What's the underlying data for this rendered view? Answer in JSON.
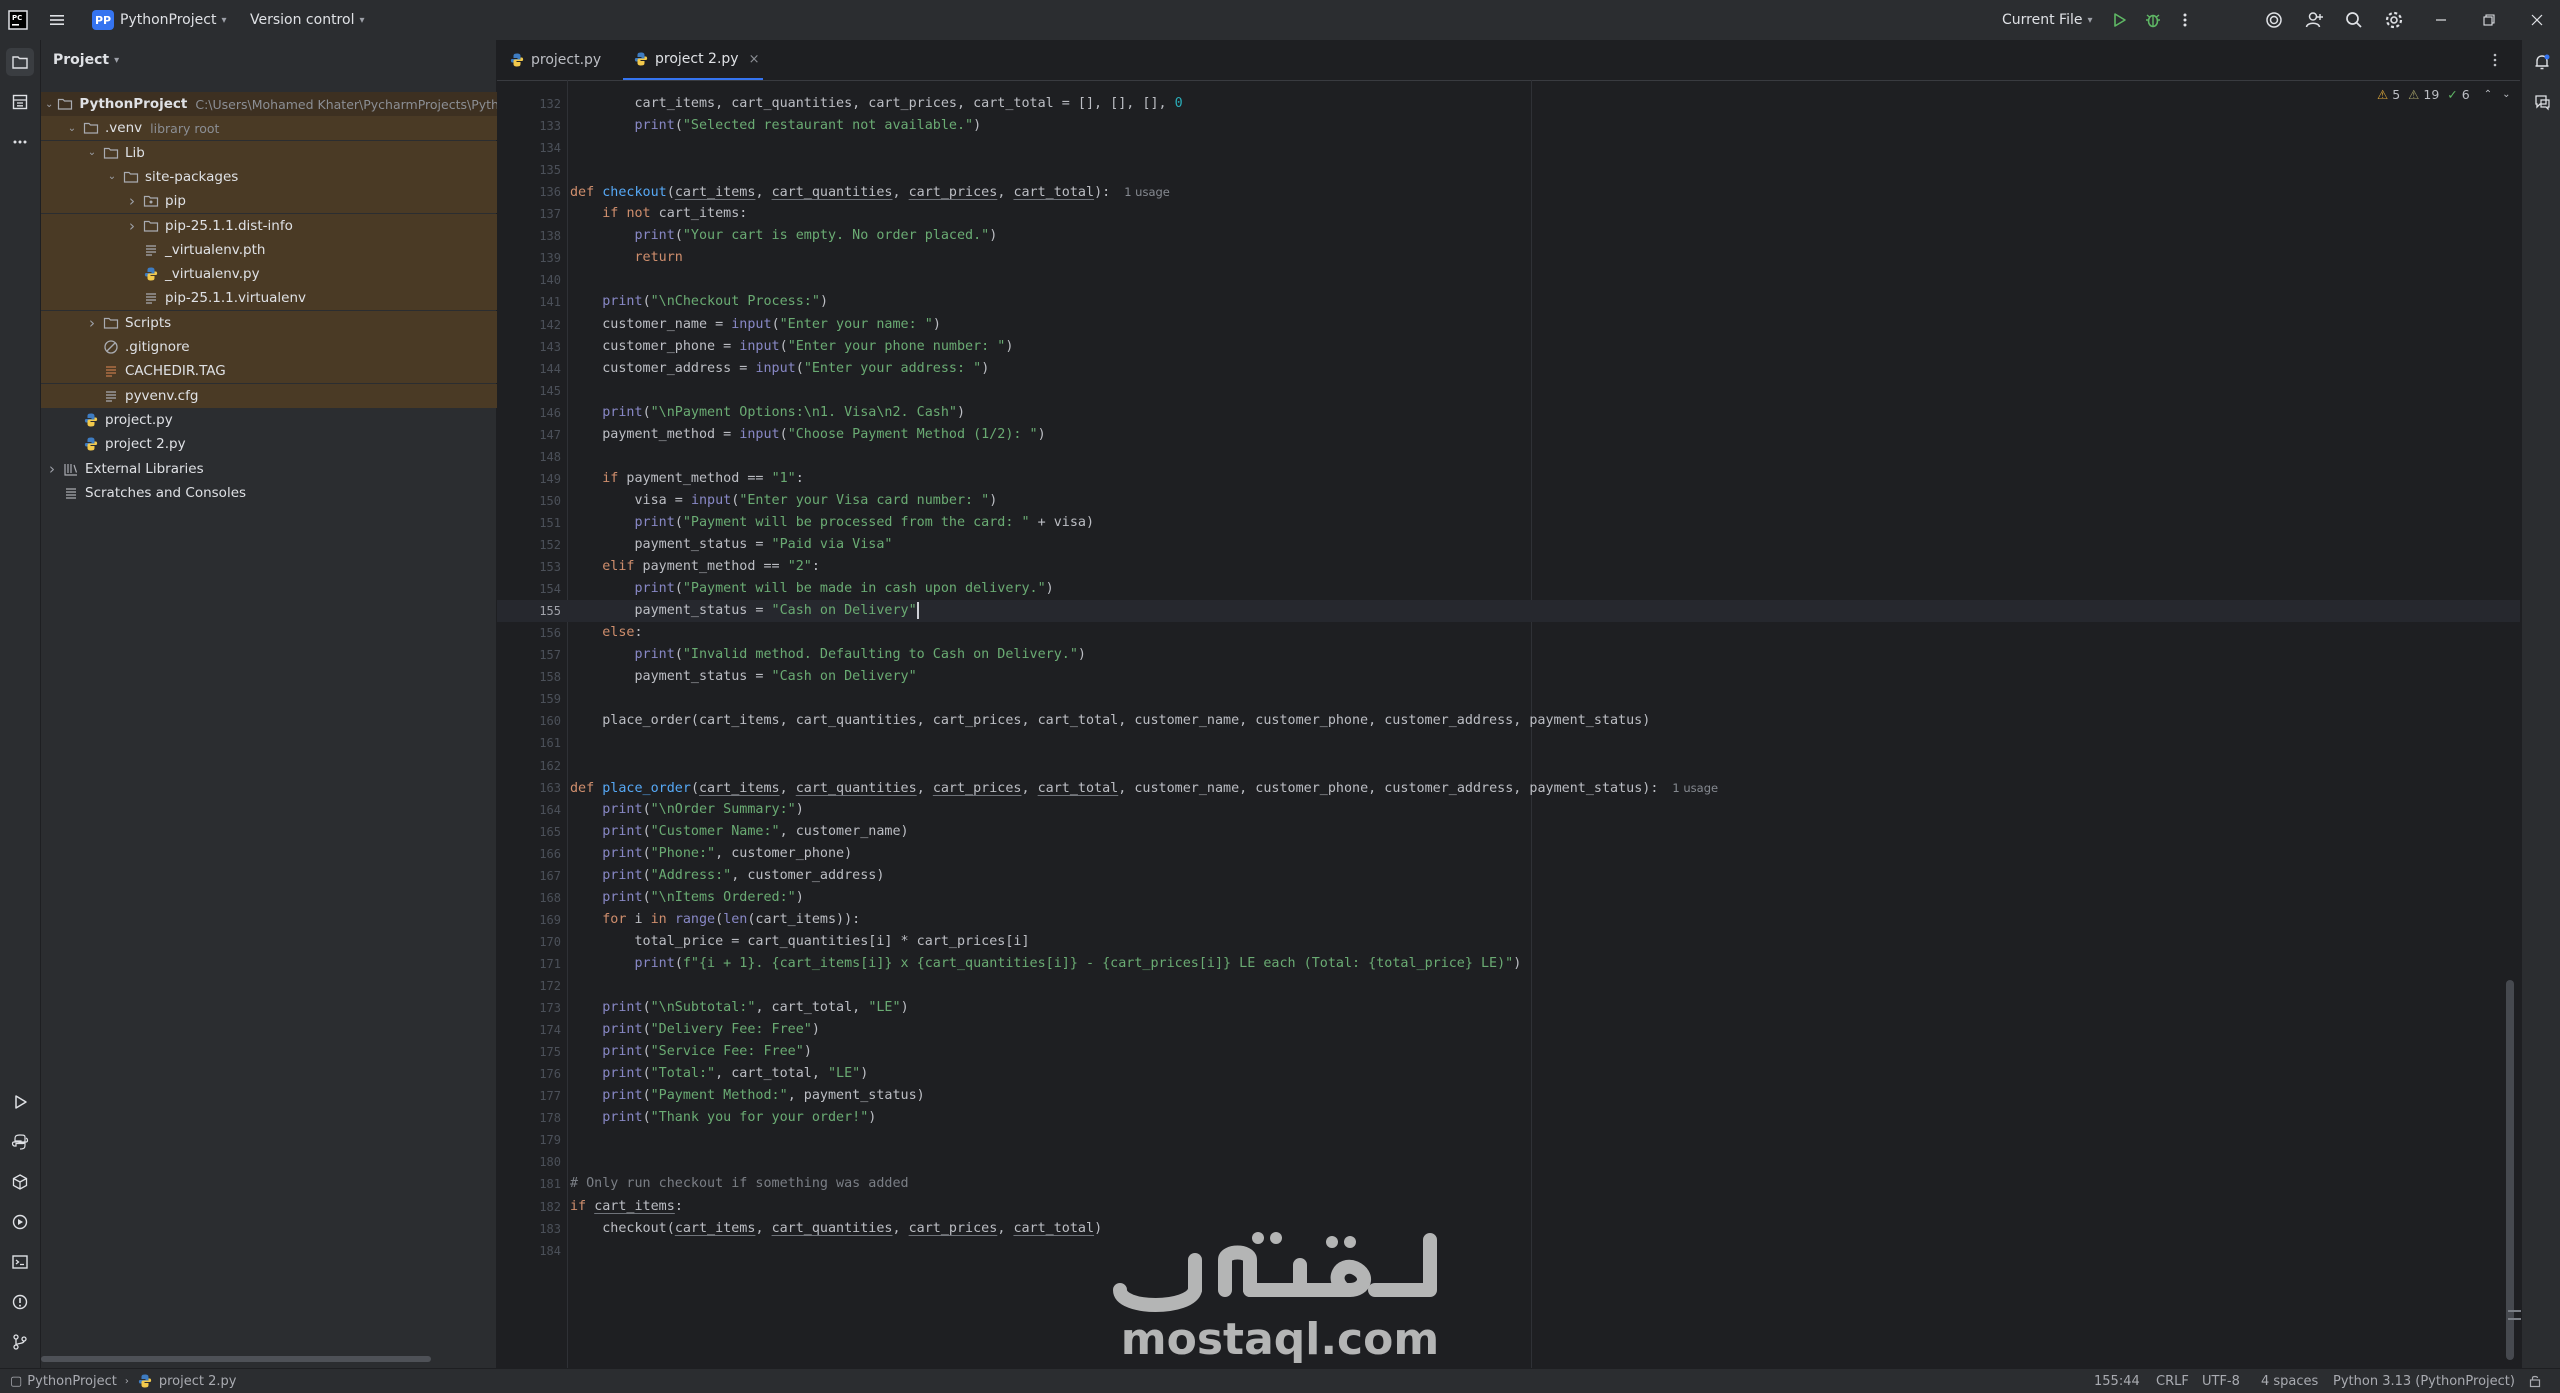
{
  "titlebar": {
    "project_badge": "PP",
    "project_name": "PythonProject",
    "vcs": "Version control",
    "run_config": "Current File"
  },
  "project_panel": {
    "title": "Project",
    "tree": [
      {
        "label": "PythonProject",
        "extra": "C:\\Users\\Mohamed Khater\\PycharmProjects\\PythonProject",
        "indent": 1,
        "twisty": "down",
        "icon": "folder-icon",
        "bold": true
      },
      {
        "label": ".venv",
        "extra": "library root",
        "indent": 2,
        "twisty": "down",
        "icon": "folder-icon"
      },
      {
        "label": "Lib",
        "extra": "",
        "indent": 3,
        "twisty": "down",
        "icon": "folder-icon"
      },
      {
        "label": "site-packages",
        "extra": "",
        "indent": 4,
        "twisty": "down",
        "icon": "folder-icon"
      },
      {
        "label": "pip",
        "extra": "",
        "indent": 5,
        "twisty": "right",
        "icon": "package-folder-icon"
      },
      {
        "label": "pip-25.1.1.dist-info",
        "extra": "",
        "indent": 5,
        "twisty": "right",
        "icon": "folder-icon"
      },
      {
        "label": "_virtualenv.pth",
        "extra": "",
        "indent": 5,
        "twisty": "",
        "icon": "text-file-icon"
      },
      {
        "label": "_virtualenv.py",
        "extra": "",
        "indent": 5,
        "twisty": "",
        "icon": "python-file-icon"
      },
      {
        "label": "pip-25.1.1.virtualenv",
        "extra": "",
        "indent": 5,
        "twisty": "",
        "icon": "text-file-icon"
      },
      {
        "label": "Scripts",
        "extra": "",
        "indent": 3,
        "twisty": "right",
        "icon": "folder-icon"
      },
      {
        "label": ".gitignore",
        "extra": "",
        "indent": 3,
        "twisty": "",
        "icon": "gitignore-icon"
      },
      {
        "label": "CACHEDIR.TAG",
        "extra": "",
        "indent": 3,
        "twisty": "",
        "icon": "tag-file-icon"
      },
      {
        "label": "pyvenv.cfg",
        "extra": "",
        "indent": 3,
        "twisty": "",
        "icon": "text-file-icon"
      },
      {
        "label": "project.py",
        "extra": "",
        "indent": 2,
        "twisty": "",
        "icon": "python-file-icon"
      },
      {
        "label": "project 2.py",
        "extra": "",
        "indent": 2,
        "twisty": "",
        "icon": "python-file-icon"
      },
      {
        "label": "External Libraries",
        "extra": "",
        "indent": 1,
        "twisty": "right",
        "icon": "library-icon"
      },
      {
        "label": "Scratches and Consoles",
        "extra": "",
        "indent": 1,
        "twisty": "",
        "icon": "scratches-icon"
      }
    ]
  },
  "tabs": [
    {
      "label": "project.py",
      "active": false
    },
    {
      "label": "project 2.py",
      "active": true
    }
  ],
  "inspections": {
    "warnings": "5",
    "weak_warnings": "19",
    "ok": "6"
  },
  "editor": {
    "current_line": 155,
    "lines": [
      {
        "n": 132,
        "text": "        cart_items, cart_quantities, cart_prices, cart_total = [], [], [], 0"
      },
      {
        "n": 133,
        "text": "        print(\"Selected restaurant not available.\")"
      },
      {
        "n": 134,
        "text": ""
      },
      {
        "n": 135,
        "text": ""
      },
      {
        "n": 136,
        "text": "def checkout(cart_items, cart_quantities, cart_prices, cart_total):",
        "hint": "1 usage"
      },
      {
        "n": 137,
        "text": "    if not cart_items:"
      },
      {
        "n": 138,
        "text": "        print(\"Your cart is empty. No order placed.\")"
      },
      {
        "n": 139,
        "text": "        return"
      },
      {
        "n": 140,
        "text": ""
      },
      {
        "n": 141,
        "text": "    print(\"\\nCheckout Process:\")"
      },
      {
        "n": 142,
        "text": "    customer_name = input(\"Enter your name: \")"
      },
      {
        "n": 143,
        "text": "    customer_phone = input(\"Enter your phone number: \")"
      },
      {
        "n": 144,
        "text": "    customer_address = input(\"Enter your address: \")"
      },
      {
        "n": 145,
        "text": ""
      },
      {
        "n": 146,
        "text": "    print(\"\\nPayment Options:\\n1. Visa\\n2. Cash\")"
      },
      {
        "n": 147,
        "text": "    payment_method = input(\"Choose Payment Method (1/2): \")"
      },
      {
        "n": 148,
        "text": ""
      },
      {
        "n": 149,
        "text": "    if payment_method == \"1\":"
      },
      {
        "n": 150,
        "text": "        visa = input(\"Enter your Visa card number: \")"
      },
      {
        "n": 151,
        "text": "        print(\"Payment will be processed from the card: \" + visa)"
      },
      {
        "n": 152,
        "text": "        payment_status = \"Paid via Visa\""
      },
      {
        "n": 153,
        "text": "    elif payment_method == \"2\":"
      },
      {
        "n": 154,
        "text": "        print(\"Payment will be made in cash upon delivery.\")"
      },
      {
        "n": 155,
        "text": "        payment_status = \"Cash on Delivery\""
      },
      {
        "n": 156,
        "text": "    else:"
      },
      {
        "n": 157,
        "text": "        print(\"Invalid method. Defaulting to Cash on Delivery.\")"
      },
      {
        "n": 158,
        "text": "        payment_status = \"Cash on Delivery\""
      },
      {
        "n": 159,
        "text": ""
      },
      {
        "n": 160,
        "text": "    place_order(cart_items, cart_quantities, cart_prices, cart_total, customer_name, customer_phone, customer_address, payment_status)"
      },
      {
        "n": 161,
        "text": ""
      },
      {
        "n": 162,
        "text": ""
      },
      {
        "n": 163,
        "text": "def place_order(cart_items, cart_quantities, cart_prices, cart_total, customer_name, customer_phone, customer_address, payment_status):",
        "hint": "1 usage"
      },
      {
        "n": 164,
        "text": "    print(\"\\nOrder Summary:\")"
      },
      {
        "n": 165,
        "text": "    print(\"Customer Name:\", customer_name)"
      },
      {
        "n": 166,
        "text": "    print(\"Phone:\", customer_phone)"
      },
      {
        "n": 167,
        "text": "    print(\"Address:\", customer_address)"
      },
      {
        "n": 168,
        "text": "    print(\"\\nItems Ordered:\")"
      },
      {
        "n": 169,
        "text": "    for i in range(len(cart_items)):"
      },
      {
        "n": 170,
        "text": "        total_price = cart_quantities[i] * cart_prices[i]"
      },
      {
        "n": 171,
        "text": "        print(f\"{i + 1}. {cart_items[i]} x {cart_quantities[i]} - {cart_prices[i]} LE each (Total: {total_price} LE)\")"
      },
      {
        "n": 172,
        "text": ""
      },
      {
        "n": 173,
        "text": "    print(\"\\nSubtotal:\", cart_total, \"LE\")"
      },
      {
        "n": 174,
        "text": "    print(\"Delivery Fee: Free\")"
      },
      {
        "n": 175,
        "text": "    print(\"Service Fee: Free\")"
      },
      {
        "n": 176,
        "text": "    print(\"Total:\", cart_total, \"LE\")"
      },
      {
        "n": 177,
        "text": "    print(\"Payment Method:\", payment_status)"
      },
      {
        "n": 178,
        "text": "    print(\"Thank you for your order!\")"
      },
      {
        "n": 179,
        "text": ""
      },
      {
        "n": 180,
        "text": ""
      },
      {
        "n": 181,
        "text": "# Only run checkout if something was added"
      },
      {
        "n": 182,
        "text": "if cart_items:"
      },
      {
        "n": 183,
        "text": "    checkout(cart_items, cart_quantities, cart_prices, cart_total)"
      },
      {
        "n": 184,
        "text": ""
      }
    ]
  },
  "statusbar": {
    "breadcrumb_project": "PythonProject",
    "breadcrumb_file": "project 2.py",
    "position": "155:44",
    "line_sep": "CRLF",
    "encoding": "UTF-8",
    "indent": "4 spaces",
    "interpreter": "Python 3.13 (PythonProject)"
  },
  "watermark": {
    "text": "mostaql.com",
    "arabic": "مستقل"
  },
  "colors": {
    "accent": "#3574f0",
    "excluded_bg": "#4a3a25",
    "string": "#6aab73",
    "keyword": "#cf8e6d",
    "function": "#56a8f5"
  }
}
